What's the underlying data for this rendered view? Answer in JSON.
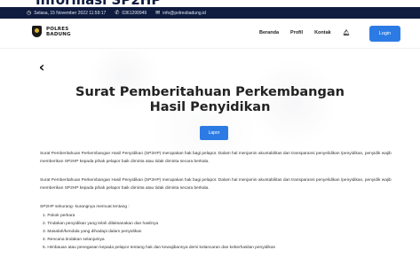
{
  "page_heading": "Informasi SP2HP",
  "topbar": {
    "datetime": "Selasa, 15 November 2022 11:59:17",
    "phone": "0361299949",
    "email": "info@polresbadung.id"
  },
  "navbar": {
    "logo_line1": "POLRES",
    "logo_line2": "BADUNG",
    "links": [
      "Beranda",
      "Profil",
      "Kontak"
    ],
    "login_label": "Login"
  },
  "main": {
    "back_label": "‹",
    "title": "Surat Pemberitahuan Perkembangan Hasil Penyidikan",
    "cta_label": "Lapor",
    "paragraph_1": "Surat Pemberitahuan Perkembangan Hasil Penyidikan (SP2HP) merupakan hak bagi pelapor. Dalam hal menjamin akuntabilitas dan transparansi penyelidikan /penyidikan, penyidik wajib memberikan SP2HP kepada pihak pelapor baik diminta atau tidak diminta secara berkala.",
    "paragraph_2": "Surat Pemberitahuan Perkembangan Hasil Penyidikan (SP2HP) merupakan hak bagi pelapor. Dalam hal menjamin akuntabilitas dan transparansi penyelidikan /penyidikan, penyidik wajib memberikan SP2HP kepada pihak pelapor baik diminta atau tidak diminta secara berkala.",
    "list_intro": "SP2HP sekurang- kurangnya memuat tentang :",
    "list": [
      "1. Pokok perkara",
      "2. Tindakan penyidikan yang telah dilaksanakan dan hasilnya",
      "3. Masalah/kendala yang dihadapi dalam penyidikan",
      "4. Rencana tindakan selanjutnya",
      "5. Himbauan atau penegasan kepada pelapor tentang hak dan kewajibannya demi kelancaran dan keberhasilan penyidikan"
    ]
  }
}
